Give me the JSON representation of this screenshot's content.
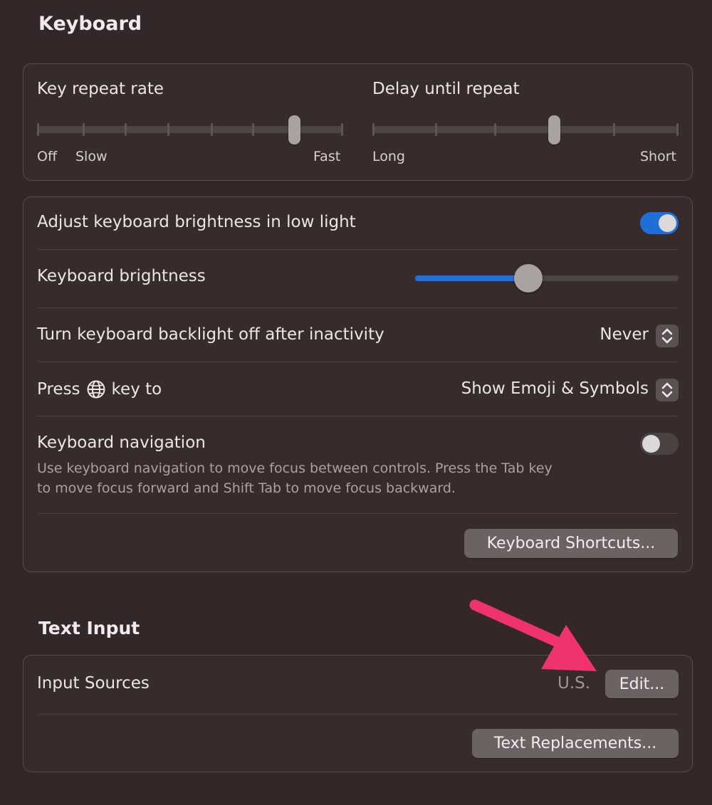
{
  "keyboard_section": {
    "title": "Keyboard"
  },
  "repeat": {
    "key_repeat_rate": {
      "label": "Key repeat rate",
      "min_label": "Off",
      "slow_label": "Slow",
      "max_label": "Fast",
      "steps": 8,
      "selected_step": 7
    },
    "delay_until_repeat": {
      "label": "Delay until repeat",
      "min_label": "Long",
      "max_label": "Short",
      "steps": 6,
      "selected_step": 4
    }
  },
  "backlight": {
    "adjust_brightness": {
      "label": "Adjust keyboard brightness in low light",
      "enabled": true
    },
    "brightness": {
      "label": "Keyboard brightness",
      "value": 0.4
    },
    "turn_off": {
      "label": "Turn keyboard backlight off after inactivity",
      "value": "Never"
    },
    "press_key": {
      "label_before": "Press",
      "label_after": "key to",
      "value": "Show Emoji & Symbols",
      "key_icon": "globe-icon"
    },
    "navigation": {
      "label": "Keyboard navigation",
      "enabled": false,
      "description_line1": "Use keyboard navigation to move focus between controls. Press the Tab key",
      "description_line2": "to move focus forward and Shift Tab to move focus backward."
    },
    "shortcuts_button": "Keyboard Shortcuts..."
  },
  "text_input_section": {
    "title": "Text Input"
  },
  "text_input": {
    "input_sources_label": "Input Sources",
    "input_sources_value": "U.S.",
    "edit_button": "Edit...",
    "text_replacements_button": "Text Replacements..."
  },
  "colors": {
    "accent": "#1f6fd7",
    "annotation_arrow": "#f0336f"
  }
}
